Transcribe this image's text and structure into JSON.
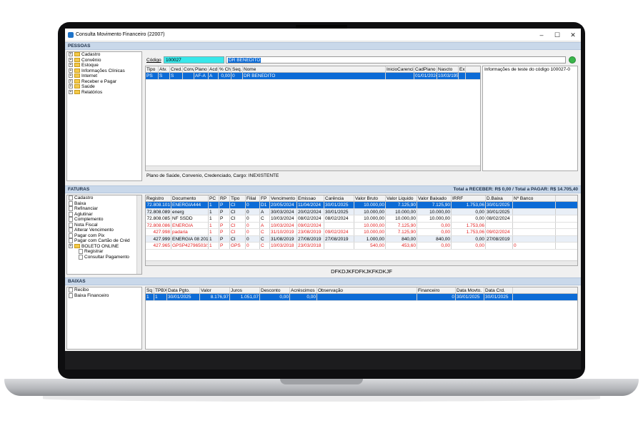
{
  "window": {
    "title": "Consulta Movimento Financeiro (22007)"
  },
  "sections": {
    "pessoas": "PESSOAS",
    "faturas": "FATURAS",
    "baixas": "BAIXAS"
  },
  "pessoas_tree": [
    "Cadastro",
    "Convênio",
    "Estoque",
    "Informações Clínicas",
    "Internet",
    "Receber e Pagar",
    "Saúde",
    "Relatórios"
  ],
  "codigo": {
    "label": "Código",
    "value": "100027",
    "name": "DR BENEDITO"
  },
  "pessoas_grid": {
    "headers": [
      "Tipo",
      "Atv.",
      "Cred.",
      "Conv.",
      "Plano",
      "Acd",
      "% Ch",
      "Seq.",
      "Nome",
      "InicioCarencia",
      "CadPlano",
      "Nascto",
      "Exi"
    ],
    "rows": [
      [
        "PS",
        "S",
        "S",
        "",
        "AF-A",
        "A",
        "0,00",
        "0",
        "DR BENEDITO",
        "",
        "01/01/2024",
        "10/03/1952",
        ""
      ]
    ]
  },
  "info_text": "Informações de teste do código 100027-0",
  "status_text": "Plano de Saúde, Convenio, Credenciado, Cargo: INEXISTENTE",
  "faturas_total": "Total a RECEBER: R$ 0,00 / Total a PAGAR: R$ 14.705,40",
  "faturas_tree": [
    "Cadastro",
    "Baixa",
    "Refinanciar",
    "Aglutinar",
    "Complemento",
    "Nota Fiscal",
    "Alterar Vencimento",
    "Pagar com Pix",
    "Pagar com Cartão de Créd",
    "BOLETO ONLINE",
    "Registrar",
    "Consultar Pagamento"
  ],
  "faturas_grid": {
    "headers": [
      "Registro",
      "Documento",
      "PC",
      "RP",
      "Tipo",
      "Filial",
      "FP",
      "Vencimento",
      "Emissao",
      "Carência",
      "Valor Bruto",
      "Valor Liquido",
      "Valor Baixado",
      "IRRF",
      "D.Baixa",
      "Nº Banco"
    ],
    "rows": [
      [
        "72.808.101",
        "ENERGIA444",
        "1",
        "P",
        "CI",
        "0",
        "D1",
        "20/05/2024",
        "11/04/2024",
        "30/01/2025",
        "10.000,00",
        "7.125,90",
        "7.125,90",
        "1.753,06",
        "30/01/2025",
        ""
      ],
      [
        "72.808.089",
        "energ",
        "1",
        "P",
        "CI",
        "0",
        "A",
        "30/03/2024",
        "20/02/2024",
        "30/01/2025",
        "10.000,00",
        "10.000,00",
        "10.000,00",
        "0,00",
        "30/01/2025",
        ""
      ],
      [
        "72.808.085",
        "NF SSDD",
        "1",
        "P",
        "CI",
        "0",
        "C",
        "10/03/2024",
        "08/02/2024",
        "08/02/2024",
        "10.000,00",
        "10.000,00",
        "10.000,00",
        "0,00",
        "08/02/2024",
        ""
      ],
      [
        "72.808.086",
        "ENERGIA",
        "1",
        "P",
        "CI",
        "0",
        "A",
        "10/03/2024",
        "09/02/2024",
        "",
        "10.000,00",
        "7.125,90",
        "0,00",
        "1.753,06",
        "",
        ""
      ],
      [
        "427.998",
        "padaria",
        "1",
        "P",
        "CI",
        "0",
        "C",
        "31/10/2019",
        "23/08/2019",
        "09/02/2024",
        "10.000,00",
        "7.125,90",
        "0,00",
        "1.753,06",
        "09/02/2024",
        ""
      ],
      [
        "427.999",
        "ENERGIA 08 2019",
        "1",
        "P",
        "CI",
        "0",
        "C",
        "31/08/2019",
        "27/08/2019",
        "27/08/2019",
        "1.000,00",
        "840,00",
        "840,00",
        "0,00",
        "27/08/2019",
        ""
      ],
      [
        "427.965",
        "GPSP42796503/18",
        "1",
        "P",
        "GPS",
        "0",
        "C",
        "10/03/2018",
        "23/03/2018",
        "",
        "540,00",
        "453,60",
        "0,00",
        "0,00",
        "",
        "0"
      ]
    ]
  },
  "faturas_footer": "DFKDJKFDFKJKFKDKJF",
  "baixas_tree": [
    "Recibo",
    "Baixa Financeiro"
  ],
  "baixas_grid": {
    "headers": [
      "Sq",
      "TPBX",
      "Data Pgto.",
      "Valor",
      "Juros",
      "Desconto",
      "Acréscimos",
      "Observação",
      "Financeiro",
      "Data Movto.",
      "Data Crd."
    ],
    "rows": [
      [
        "1",
        "1",
        "30/01/2025",
        "8.176,97",
        "1.051,07",
        "0,00",
        "0,00",
        "",
        "0",
        "30/01/2025",
        "30/01/2025"
      ]
    ]
  },
  "colors": {
    "selection": "#0c6bd6",
    "section": "#c9d8ea",
    "code_field": "#37e7ea",
    "red_text": "#e11f1f"
  }
}
